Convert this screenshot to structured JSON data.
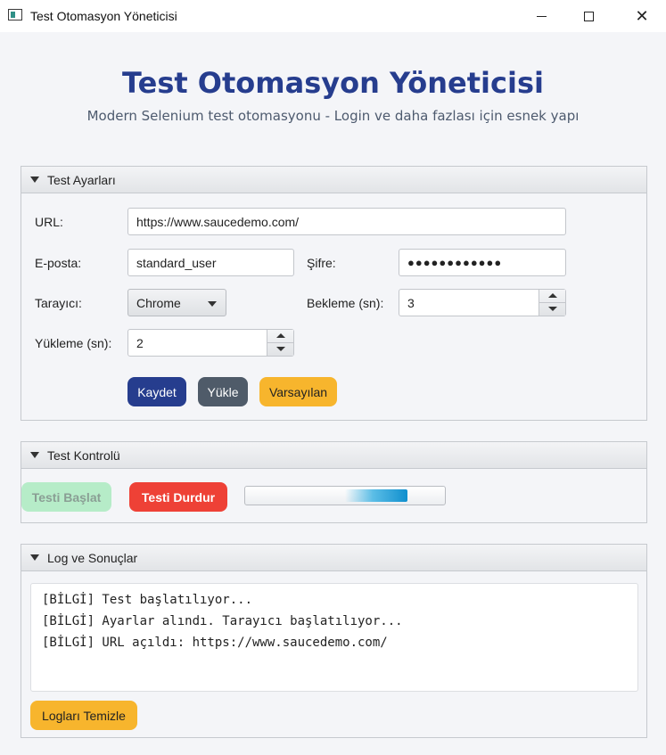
{
  "window": {
    "title": "Test Otomasyon Yöneticisi",
    "close_glyph": "✕"
  },
  "header": {
    "title": "Test Otomasyon Yöneticisi",
    "subtitle": "Modern Selenium test otomasyonu - Login ve daha fazlası için esnek yapı"
  },
  "settings": {
    "title": "Test Ayarları",
    "url_label": "URL:",
    "url_value": "https://www.saucedemo.com/",
    "email_label": "E-posta:",
    "email_value": "standard_user",
    "password_label": "Şifre:",
    "password_mask": "●●●●●●●●●●●●",
    "browser_label": "Tarayıcı:",
    "browser_value": "Chrome",
    "wait_label": "Bekleme (sn):",
    "wait_value": "3",
    "load_label": "Yükleme (sn):",
    "load_value": "2",
    "save_label": "Kaydet",
    "load_button_label": "Yükle",
    "default_label": "Varsayılan"
  },
  "control": {
    "title": "Test Kontrolü",
    "start_label": "Testi Başlat",
    "stop_label": "Testi Durdur",
    "progress_state": "indeterminate"
  },
  "logs": {
    "title": "Log ve Sonuçlar",
    "lines": [
      "[BİLGİ] Test başlatılıyor...",
      "[BİLGİ] Ayarlar alındı. Tarayıcı başlatılıyor...",
      "[BİLGİ] URL açıldı: https://www.saucedemo.com/"
    ],
    "clear_label": "Logları Temizle"
  },
  "colors": {
    "primary": "#263d8e",
    "secondary": "#4f5b69",
    "warning": "#f7b52d",
    "danger": "#ee4136",
    "success_disabled": "#b6ecc8",
    "progress": "#0f8fce"
  }
}
